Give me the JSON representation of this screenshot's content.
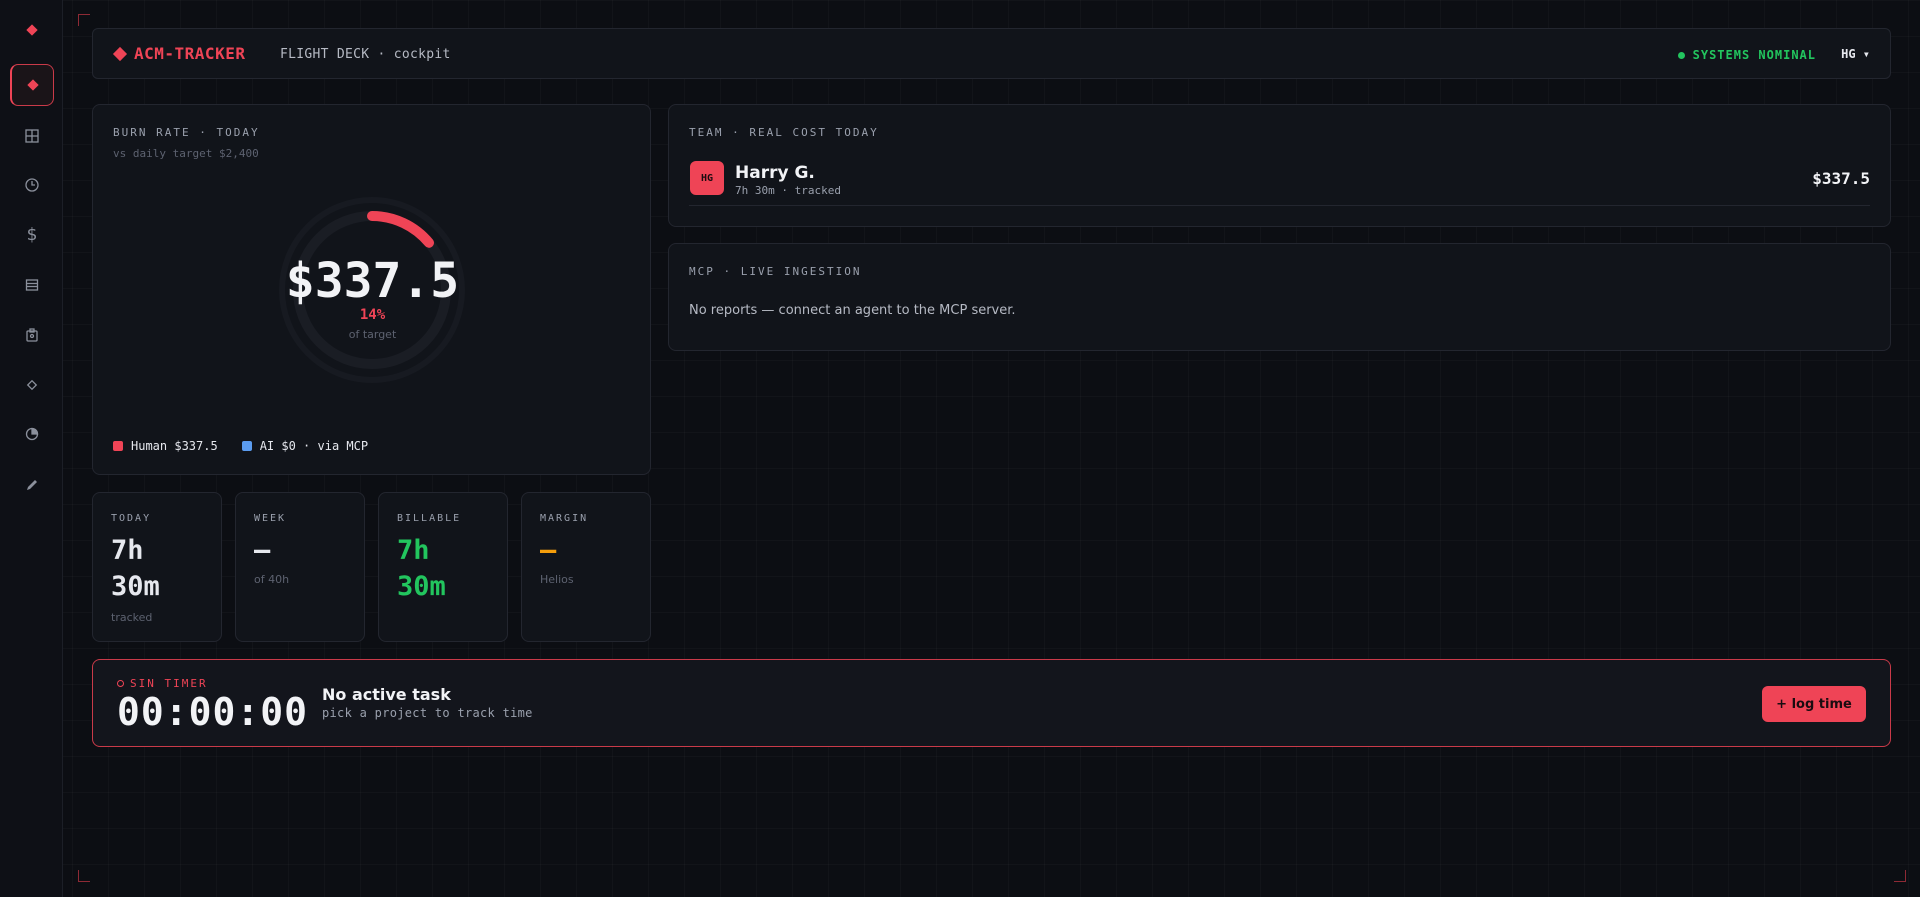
{
  "colors": {
    "accent": "#ef4456",
    "success": "#22c55e",
    "ai": "#5b9cf0",
    "warn": "#f59e0b",
    "background": "#0c0e13",
    "panel": "#11141a"
  },
  "sidebar": {
    "items": [
      {
        "icon": "logo-diamond-icon",
        "active": false
      },
      {
        "icon": "cockpit-diamond-icon",
        "active": true
      },
      {
        "icon": "grid-icon",
        "active": false
      },
      {
        "icon": "clock-icon",
        "active": false
      },
      {
        "icon": "dollar-icon",
        "active": false
      },
      {
        "icon": "list-icon",
        "active": false
      },
      {
        "icon": "clipboard-icon",
        "active": false
      },
      {
        "icon": "diamond-outline-icon",
        "active": false
      },
      {
        "icon": "pie-icon",
        "active": false
      },
      {
        "icon": "pencil-icon",
        "active": false
      }
    ],
    "dollar_glyph": "$"
  },
  "header": {
    "brand": "ACM-TRACKER",
    "breadcrumb": "FLIGHT DECK · cockpit",
    "status": "SYSTEMS NOMINAL",
    "user_menu": "HG ▾"
  },
  "burn": {
    "label": "BURN RATE · TODAY",
    "target_text": "vs daily target $2,400",
    "value": "$337.5",
    "percent_text": "14%",
    "percent_of_target": 0.14,
    "caption": "of target",
    "legend": {
      "human": "Human $337.5",
      "ai": "AI $0 · via MCP"
    }
  },
  "stats": {
    "today": {
      "label": "TODAY",
      "value_line1": "7h",
      "value_line2": "30m",
      "sub": "tracked"
    },
    "week": {
      "label": "WEEK",
      "value": "—",
      "sub": "of 40h"
    },
    "billable": {
      "label": "BILLABLE",
      "value_line1": "7h",
      "value_line2": "30m"
    },
    "margin": {
      "label": "MARGIN",
      "value": "—",
      "sub": "Helios"
    }
  },
  "team": {
    "label": "TEAM · REAL COST TODAY",
    "members": [
      {
        "initials": "HG",
        "name": "Harry G.",
        "meta": "7h 30m · tracked",
        "cost": "$337.5"
      }
    ]
  },
  "mcp": {
    "label": "MCP · LIVE INGESTION",
    "message": "No reports — connect an agent to the MCP server."
  },
  "timer": {
    "label": "SIN TIMER",
    "clock": "00:00:00",
    "task_title": "No active task",
    "task_sub": "pick a project to track time",
    "button": "+ log time"
  }
}
